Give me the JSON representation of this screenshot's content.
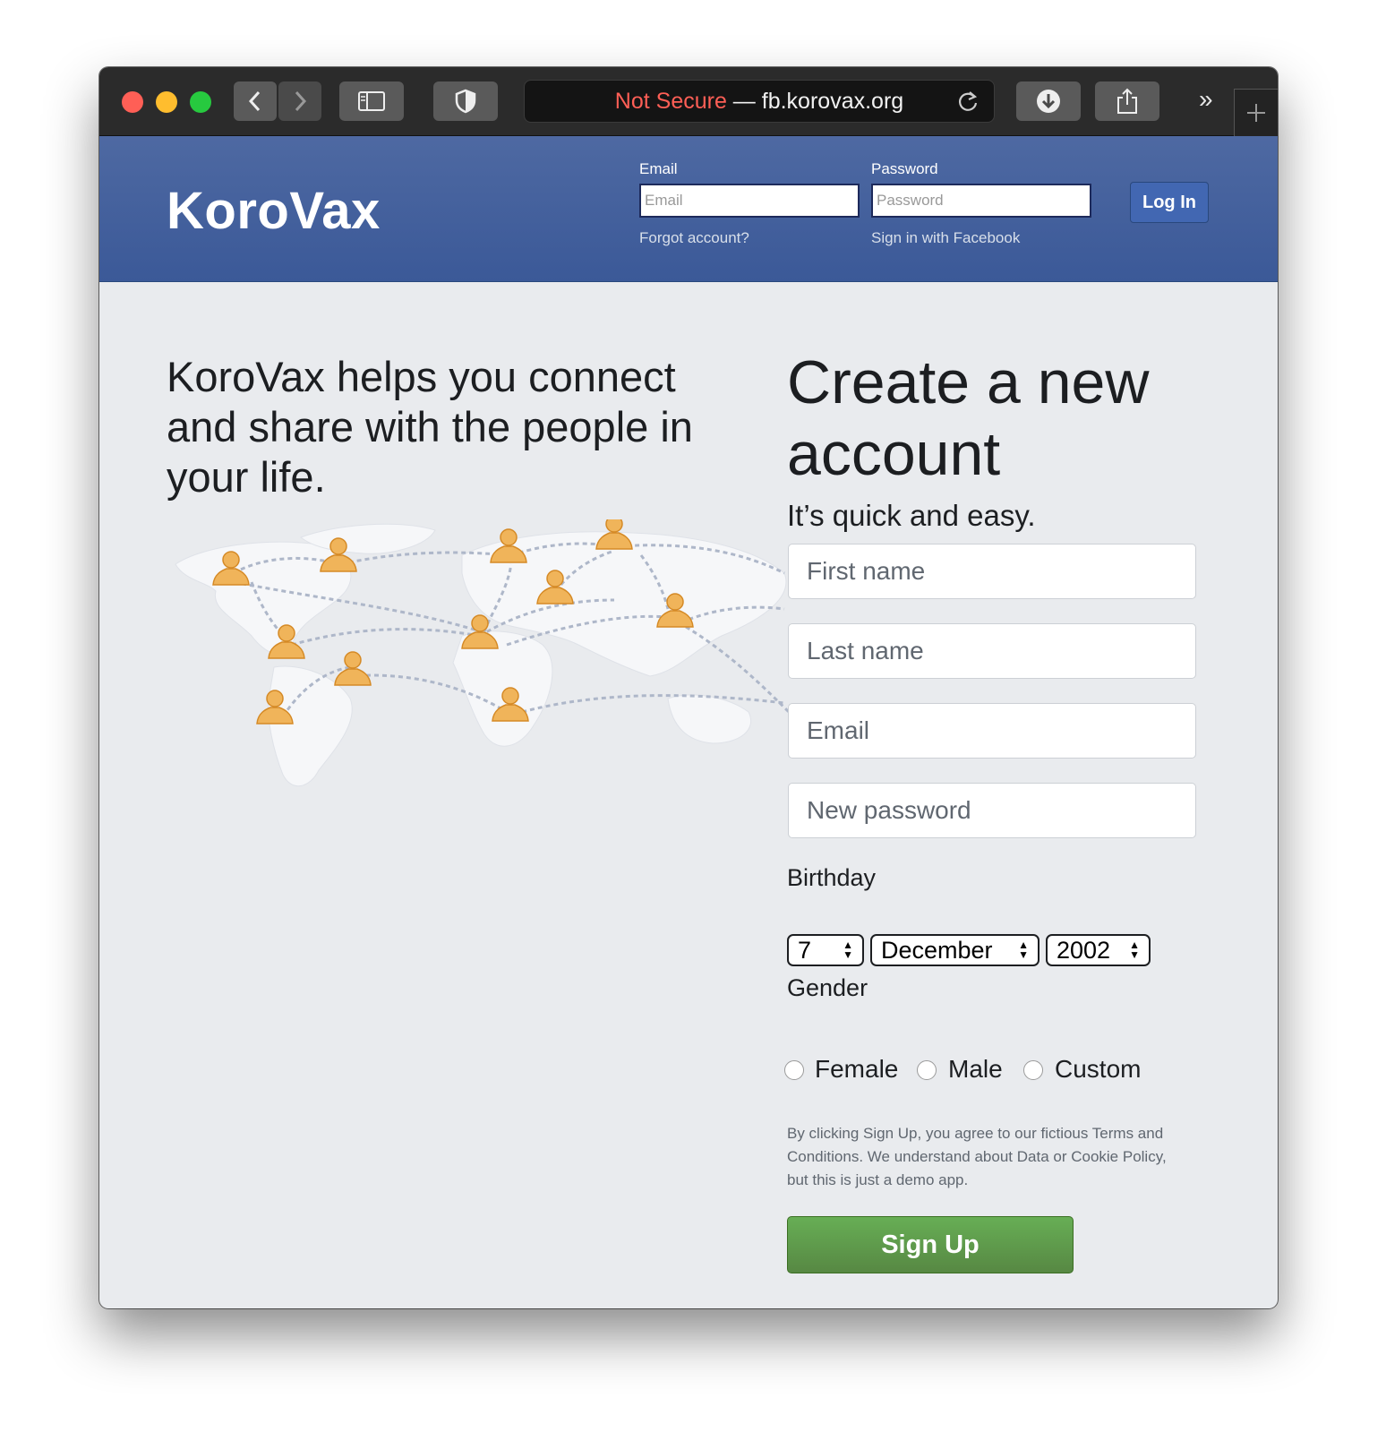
{
  "browser": {
    "url_security": "Not Secure",
    "url_separator": " — ",
    "url_host": "fb.korovax.org"
  },
  "header": {
    "logo": "KoroVax",
    "email_label": "Email",
    "email_placeholder": "Email",
    "password_label": "Password",
    "password_placeholder": "Password",
    "login_label": "Log In",
    "forgot_link": "Forgot account?",
    "facebook_link": "Sign in with Facebook"
  },
  "main": {
    "tagline": "KoroVax helps you connect and share with the people in your life.",
    "map_icon": "world-network-map"
  },
  "signup": {
    "title": "Create a new account",
    "subtitle": "It’s quick and easy.",
    "first_name_placeholder": "First name",
    "last_name_placeholder": "Last name",
    "email_placeholder": "Email",
    "password_placeholder": "New password",
    "birthday_label": "Birthday",
    "birthday_day": "7",
    "birthday_month": "December",
    "birthday_year": "2002",
    "gender_label": "Gender",
    "gender_options": [
      "Female",
      "Male",
      "Custom"
    ],
    "terms": "By clicking Sign Up, you agree to our fictious Terms and Conditions. We understand about Data or Cookie Policy, but this is just a demo app.",
    "button": "Sign Up"
  },
  "colors": {
    "header_blue": "#3b5998",
    "signup_green": "#5fa04b",
    "not_secure_red": "#ff5f56"
  }
}
